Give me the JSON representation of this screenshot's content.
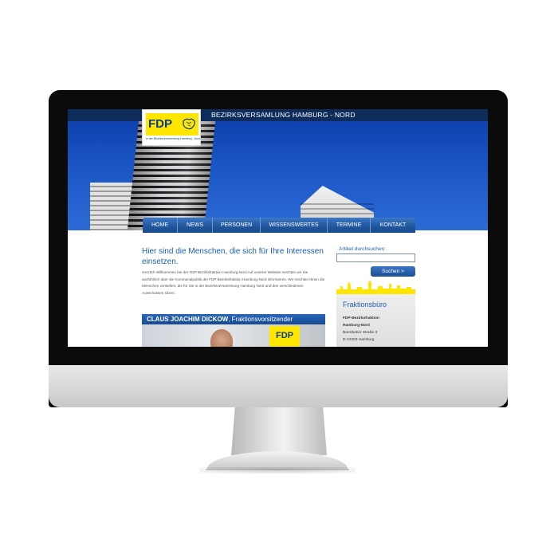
{
  "site": {
    "title": "BEZIRKSVERSAMLUNG HAMBURG - NORD",
    "logo_text": "FDP",
    "logo_subtitle": "in der Bezirksversammlung Hamburg - Nord"
  },
  "nav": {
    "items": [
      "HOME",
      "NEWS",
      "PERSONEN",
      "WISSENSWERTES",
      "TERMINE",
      "KONTAKT"
    ]
  },
  "main": {
    "headline": "Hier sind die Menschen, die sich für Ihre Interessen einsetzen.",
    "intro": "Herzlich Willkommen bei der FDP Bezirksfraktion Hamburg-Nord Auf unserer Website möchten wir Sie ausführlich über die Kommunalpolitik der FDP Bezirksfraktion Hamburg-Nord informieren. Wir möchten Ihnen die Menschen vorstellen, die für Sie in der Bezirksversammlung Hamburg Nord und den verschiedenen Ausschüssen sitzen.",
    "feature": {
      "name": "CLAUS JOACHIM DICKOW",
      "role": ", Fraktionsvorsitzender",
      "sign_text": "FDP"
    }
  },
  "sidebar": {
    "search_label": "Artikel durchsuchen:",
    "search_value": "",
    "search_button": "Suchen >",
    "office_title": "Fraktionsbüro",
    "address": {
      "line1": "FDP-Bezirksfraktion",
      "line2": "Hamburg-Nord",
      "line3": "Barmbeker Straße 3",
      "line4": "D-22303 Hamburg"
    }
  },
  "colors": {
    "brand_blue": "#1a5fb4",
    "nav_blue": "#21589f",
    "fdp_yellow": "#ffe600",
    "sky_blue": "#1a54c4"
  }
}
